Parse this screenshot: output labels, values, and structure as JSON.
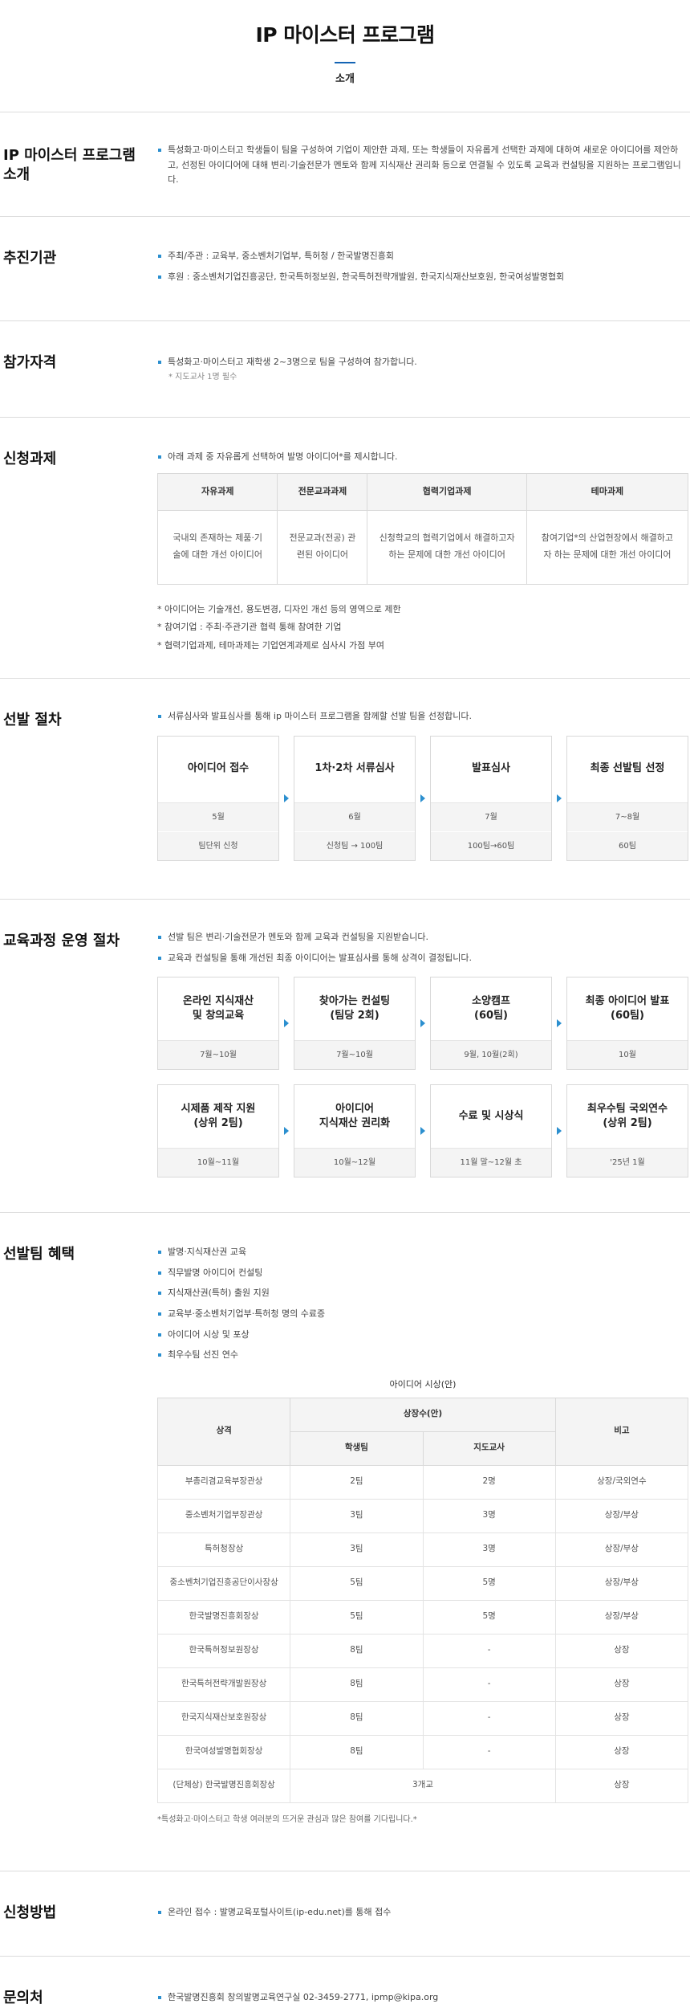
{
  "header": {
    "title": "IP 마이스터 프로그램",
    "subtitle": "소개"
  },
  "intro": {
    "title": "IP 마이스터 프로그램 소개",
    "text": "특성화고·마이스터고 학생들이 팀을 구성하여 기업이 제안한 과제, 또는 학생들이 자유롭게 선택한 과제에 대하여 새로운 아이디어를 제안하고, 선정된 아이디어에 대해 변리·기술전문가 멘토와 함께 지식재산 권리화 등으로 연결될 수 있도록 교육과 컨설팅을 지원하는 프로그램입니다."
  },
  "org": {
    "title": "추진기관",
    "items": [
      "주최/주관 : 교육부, 중소벤처기업부, 특허청 / 한국발명진흥회",
      "후원 : 중소벤처기업진흥공단, 한국특허정보원, 한국특허전략개발원, 한국지식재산보호원, 한국여성발명협회"
    ]
  },
  "eligibility": {
    "title": "참가자격",
    "item": "특성화고·마이스터고 재학생 2~3명으로 팀을 구성하여 참가합니다.",
    "note": "* 지도교사 1명 필수"
  },
  "topics": {
    "title": "신청과제",
    "lead": "아래 과제 중 자유롭게 선택하여 발명 아이디어*를 제시합니다.",
    "columns": [
      {
        "head": "자유과제",
        "desc": "국내외 존재하는 제품·기술에 대한 개선 아이디어"
      },
      {
        "head": "전문교과과제",
        "desc": "전문교과(전공) 관련된 아이디어"
      },
      {
        "head": "협력기업과제",
        "desc": "신청학교의 협력기업에서 해결하고자 하는 문제에 대한 개선 아이디어"
      },
      {
        "head": "테마과제",
        "desc": "참여기업*의 산업현장에서 해결하고자 하는 문제에 대한 개선 아이디어"
      }
    ],
    "notes": [
      "* 아이디어는 기술개선, 용도변경, 디자인 개선 등의 영역으로 제한",
      "* 참여기업 : 주최·주관기관 협력 통해 참여한 기업",
      "* 협력기업과제, 테마과제는 기업연계과제로 심사시 가점 부여"
    ]
  },
  "selection": {
    "title": "선발 절차",
    "lead": "서류심사와 발표심사를 통해 ip 마이스터 프로그램을 함께할 선발 팀을 선정합니다.",
    "steps": [
      {
        "name": "아이디어 접수",
        "month": "5월",
        "detail": "팀단위 신청"
      },
      {
        "name": "1차·2차 서류심사",
        "month": "6월",
        "detail": "신청팀 → 100팀"
      },
      {
        "name": "발표심사",
        "month": "7월",
        "detail": "100팀→60팀"
      },
      {
        "name": "최종 선발팀 선정",
        "month": "7~8월",
        "detail": "60팀"
      }
    ]
  },
  "education": {
    "title": "교육과정 운영 절차",
    "leads": [
      "선발 팀은 변리·기술전문가 멘토와 함께 교육과 컨설팅을 지원받습니다.",
      "교육과 컨설팅을 통해 개선된 최종 아이디어는 발표심사를 통해 상격이 결정됩니다."
    ],
    "row1": [
      {
        "name": "온라인 지식재산\n및 창의교육",
        "period": "7월~10월"
      },
      {
        "name": "찾아가는 컨설팅\n(팀당 2회)",
        "period": "7월~10월"
      },
      {
        "name": "소양캠프\n(60팀)",
        "period": "9월, 10월(2회)"
      },
      {
        "name": "최종 아이디어 발표\n(60팀)",
        "period": "10월"
      }
    ],
    "row2": [
      {
        "name": "시제품 제작 지원\n(상위 2팀)",
        "period": "10월~11월"
      },
      {
        "name": "아이디어\n지식재산 권리화",
        "period": "10월~12월"
      },
      {
        "name": "수료 및 시상식",
        "period": "11월 말~12월 초"
      },
      {
        "name": "최우수팀 국외연수\n(상위 2팀)",
        "period": "'25년 1월"
      }
    ]
  },
  "benefits": {
    "title": "선발팀 혜택",
    "items": [
      "발명·지식재산권 교육",
      "직무발명 아이디어 컨설팅",
      "지식재산권(특허) 출원 지원",
      "교육부·중소벤처기업부·특허청 명의 수료증",
      "아이디어 시상 및 포상",
      "최우수팀 선진 연수"
    ],
    "awards": {
      "caption": "아이디어 시상(안)",
      "head_award": "상격",
      "head_count": "상장수(안)",
      "head_student": "학생팀",
      "head_teacher": "지도교사",
      "head_note": "비고",
      "rows": [
        {
          "name": "부총리겸교육부장관상",
          "student": "2팀",
          "teacher": "2명",
          "note": "상장/국외연수"
        },
        {
          "name": "중소벤처기업부장관상",
          "student": "3팀",
          "teacher": "3명",
          "note": "상장/부상"
        },
        {
          "name": "특허청장상",
          "student": "3팀",
          "teacher": "3명",
          "note": "상장/부상"
        },
        {
          "name": "중소벤처기업진흥공단이사장상",
          "student": "5팀",
          "teacher": "5명",
          "note": "상장/부상"
        },
        {
          "name": "한국발명진흥회장상",
          "student": "5팀",
          "teacher": "5명",
          "note": "상장/부상"
        },
        {
          "name": "한국특허정보원장상",
          "student": "8팀",
          "teacher": "-",
          "note": "상장"
        },
        {
          "name": "한국특허전략개발원장상",
          "student": "8팀",
          "teacher": "-",
          "note": "상장"
        },
        {
          "name": "한국지식재산보호원장상",
          "student": "8팀",
          "teacher": "-",
          "note": "상장"
        },
        {
          "name": "한국여성발명협회장상",
          "student": "8팀",
          "teacher": "-",
          "note": "상장"
        }
      ],
      "group_row": {
        "name": "(단체상) 한국발명진흥회장상",
        "count": "3개교",
        "note": "상장"
      },
      "footnote": "*특성화고·마이스터고 학생 여러분의 뜨거운 관심과 많은 참여를 기다립니다.*"
    }
  },
  "apply": {
    "title": "신청방법",
    "item": "온라인 접수 : 발명교육포털사이트(ip-edu.net)를 통해 접수"
  },
  "contact": {
    "title": "문의처",
    "item": "한국발명진흥회 창의발명교육연구실 02-3459-2771, ipmp@kipa.org"
  }
}
